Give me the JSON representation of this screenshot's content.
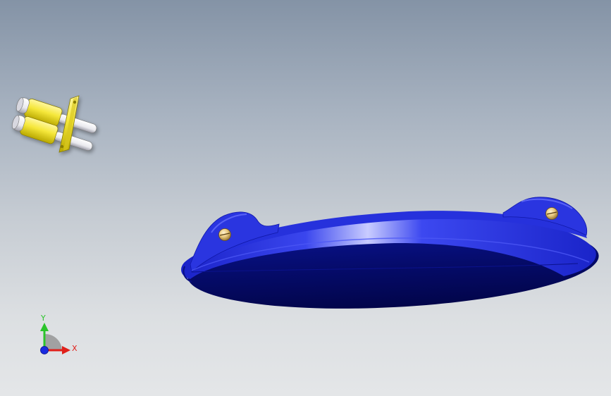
{
  "viewport": {
    "background_top": "#8493a6",
    "background_bottom": "#e4e6e8"
  },
  "parts": {
    "connector_color": "#f5e73a",
    "plate_color": "#1f2ad0",
    "plate_shadow_color": "#03075a",
    "screw_color": "#e8c77c"
  },
  "triad": {
    "x_label": "X",
    "y_label": "Y",
    "x_color": "#e0201a",
    "y_color": "#2bc42b",
    "z_color": "#1a2ae0"
  }
}
